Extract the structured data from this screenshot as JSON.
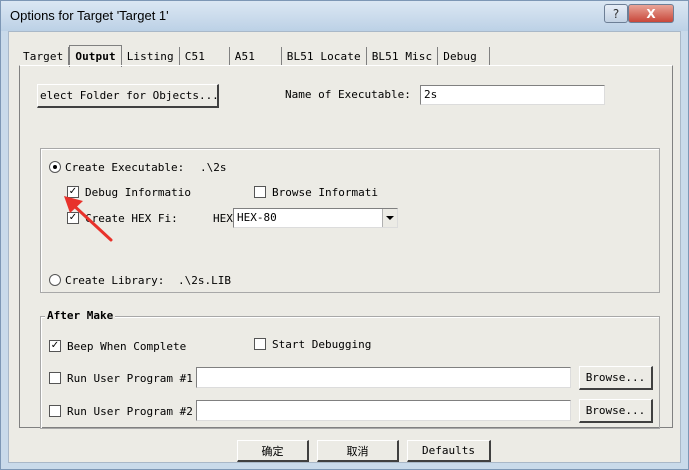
{
  "window": {
    "title": "Options for Target 'Target 1'",
    "help_glyph": "?",
    "close_glyph": "X"
  },
  "tabs": [
    {
      "label": "Target",
      "active": false
    },
    {
      "label": "Output",
      "active": true
    },
    {
      "label": "Listing",
      "active": false
    },
    {
      "label": "C51",
      "active": false
    },
    {
      "label": "A51",
      "active": false
    },
    {
      "label": "BL51 Locate",
      "active": false
    },
    {
      "label": "BL51 Misc",
      "active": false
    },
    {
      "label": "Debug",
      "active": false
    }
  ],
  "output": {
    "select_folder_label": "elect Folder for Objects...",
    "name_exe_label": "Name of Executable:",
    "name_exe_value": "2s",
    "create_exe": {
      "label": "Create Executable:",
      "path": ".\\2s",
      "selected": true
    },
    "debug_info": {
      "label": "Debug Informatio",
      "checked": true
    },
    "browse_info": {
      "label": "Browse Informati",
      "checked": false
    },
    "create_hex": {
      "label": "Create HEX Fi:",
      "checked": true
    },
    "hex_label": "HEX",
    "hex_format": "HEX-80",
    "create_lib": {
      "label": "Create Library:",
      "path": ".\\2s.LIB",
      "selected": false
    }
  },
  "after_make": {
    "title": "After Make",
    "beep": {
      "label": "Beep When Complete",
      "checked": true
    },
    "start_debug": {
      "label": "Start Debugging",
      "checked": false
    },
    "run1": {
      "label": "Run User Program #1",
      "checked": false,
      "value": ""
    },
    "run2": {
      "label": "Run User Program #2",
      "checked": false,
      "value": ""
    },
    "browse_label": "Browse..."
  },
  "buttons": {
    "ok": "确定",
    "cancel": "取消",
    "defaults": "Defaults"
  },
  "colors": {
    "annotation_arrow": "#e8322b"
  }
}
